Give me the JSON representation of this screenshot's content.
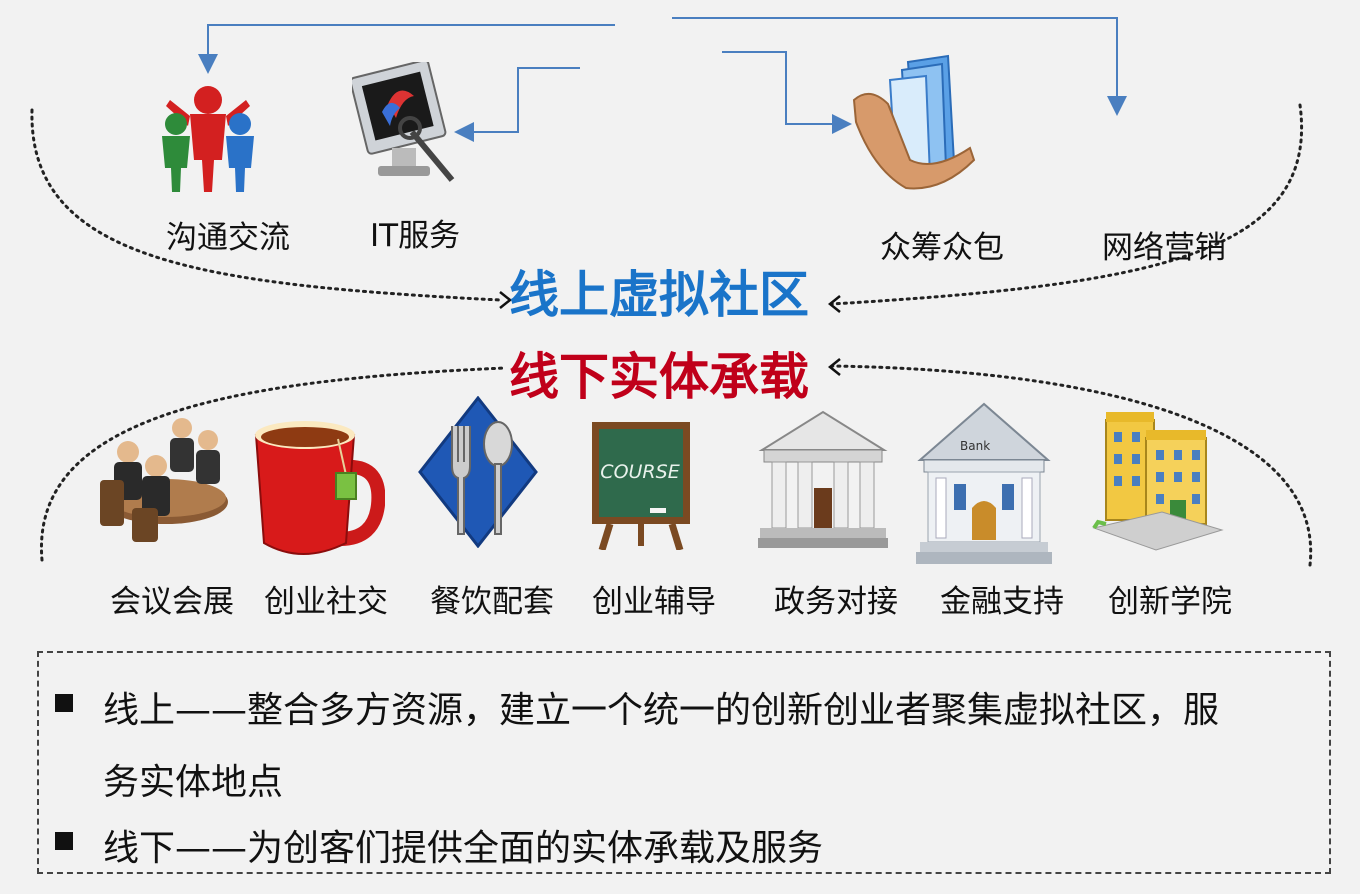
{
  "online_heading": "线上虚拟社区",
  "offline_heading": "线下实体承载",
  "online_services": [
    {
      "label": "沟通交流",
      "icon": "people-communication-icon"
    },
    {
      "label": "IT服务",
      "icon": "computer-monitor-icon"
    },
    {
      "label": "众筹众包",
      "icon": "hand-holding-documents-icon"
    },
    {
      "label": "网络营销",
      "icon": ""
    }
  ],
  "offline_services": [
    {
      "label": "会议会展",
      "icon": "meeting-table-icon"
    },
    {
      "label": "创业社交",
      "icon": "tea-cup-icon"
    },
    {
      "label": "餐饮配套",
      "icon": "fork-spoon-icon"
    },
    {
      "label": "创业辅导",
      "icon": "chalkboard-icon"
    },
    {
      "label": "政务对接",
      "icon": "government-building-icon"
    },
    {
      "label": "金融支持",
      "icon": "bank-icon"
    },
    {
      "label": "创新学院",
      "icon": "school-building-icon"
    }
  ],
  "chalkboard_text": "COURSE",
  "bank_sign": "Bank",
  "info": {
    "line1a": "线上——整合多方资源，建立一个统一的创新创业者聚集虚拟社区，服",
    "line1b": "务实体地点",
    "line2": "线下——为创客们提供全面的实体承载及服务"
  },
  "colors": {
    "online": "#1a74c9",
    "offline": "#c0001a",
    "arrow": "#4a7fc0"
  }
}
